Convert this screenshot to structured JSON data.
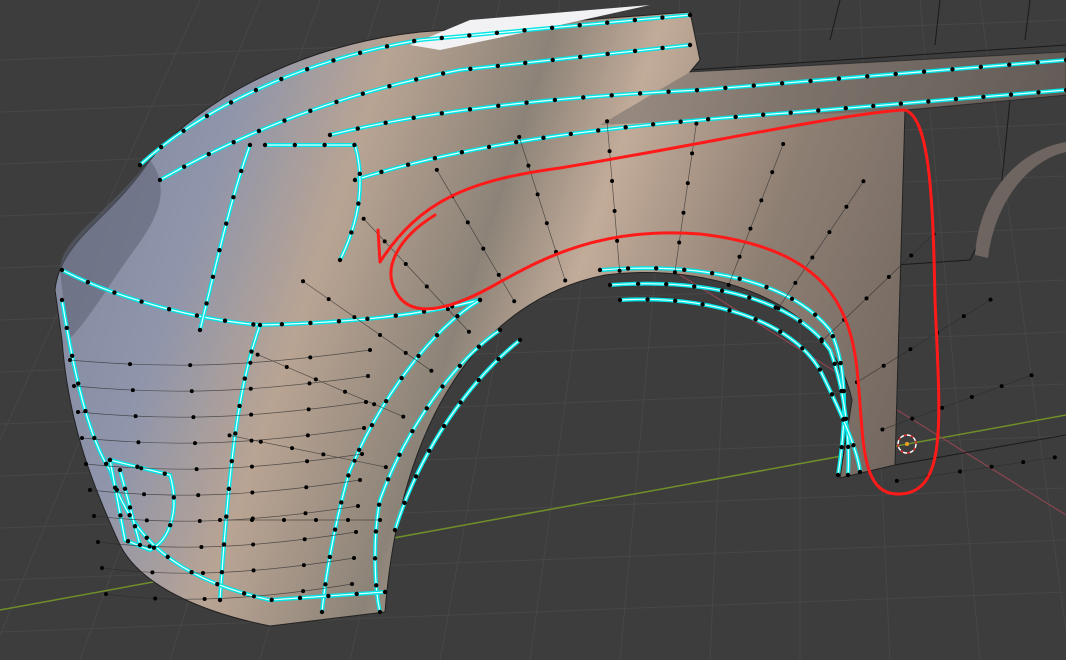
{
  "viewport": {
    "mode": "edit-mode-mesh",
    "colors": {
      "background": "#3d3d3d",
      "grid": "#4a4a4a",
      "x_axis": "#7a9a2e",
      "y_axis": "#9a4a55",
      "seam_edges": "#00e5e5",
      "vertices": "#000000",
      "annotation": "#ff1a1a",
      "mesh_light": "#c8b4a2",
      "mesh_cool": "#8a90a8"
    },
    "icons": [
      "3d-cursor-icon"
    ]
  }
}
